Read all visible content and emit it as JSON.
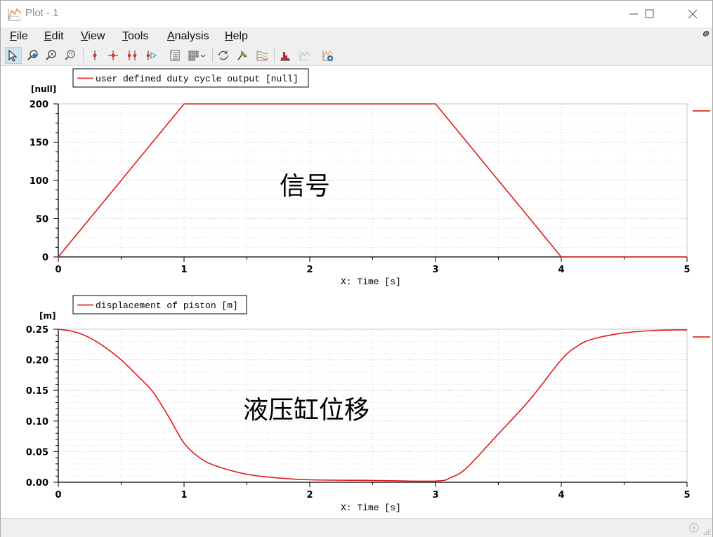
{
  "window": {
    "title": "Plot - 1",
    "controls": [
      "minimize",
      "maximize",
      "close"
    ]
  },
  "menu": [
    {
      "label": "File",
      "mnemonic": "F",
      "rest": "ile"
    },
    {
      "label": "Edit",
      "mnemonic": "E",
      "rest": "dit"
    },
    {
      "label": "View",
      "mnemonic": "V",
      "rest": "iew"
    },
    {
      "label": "Tools",
      "mnemonic": "T",
      "rest": "ools"
    },
    {
      "label": "Analysis",
      "mnemonic": "A",
      "rest": "nalysis"
    },
    {
      "label": "Help",
      "mnemonic": "H",
      "rest": "elp"
    }
  ],
  "toolbar": {
    "icons": [
      "select-arrow-icon",
      "zoom-region-icon",
      "zoom-fit-icon",
      "zoom-reset-icon",
      "vertical-cursor-icon",
      "crosshair-cursor-icon",
      "double-cursor-icon",
      "cursor-play-icon",
      "legend-list-icon",
      "layout-grid-icon",
      "refresh-icon",
      "pin-icon",
      "curves-icon",
      "histogram-icon",
      "xy-plot-icon",
      "add-plot-icon"
    ]
  },
  "colors": {
    "series": "#e01b1b",
    "legend_swatch": "#e8433a",
    "grid": "#c8c8c8",
    "frame": "#c4c4c4",
    "chrome": "#efefef"
  },
  "chart_data": [
    {
      "type": "line",
      "title": "",
      "legend": [
        "user defined duty cycle output [null]"
      ],
      "legend_placement": "top-left",
      "xlabel": "X: Time [s]",
      "ylabel": "[null]",
      "xlim": [
        0,
        5
      ],
      "ylim": [
        0,
        200
      ],
      "x_ticks": [
        "0",
        "1",
        "2",
        "3",
        "4",
        "5"
      ],
      "y_ticks": [
        "0",
        "50",
        "100",
        "150",
        "200"
      ],
      "grid": true,
      "annotation": "信号",
      "series": [
        {
          "name": "user defined duty cycle output [null]",
          "x": [
            0,
            1,
            3,
            4,
            5
          ],
          "y": [
            0,
            200,
            200,
            0,
            0
          ]
        }
      ]
    },
    {
      "type": "line",
      "title": "",
      "legend": [
        "displacement of piston [m]"
      ],
      "legend_placement": "top-left",
      "xlabel": "X: Time [s]",
      "ylabel": "[m]",
      "xlim": [
        0,
        5
      ],
      "ylim": [
        0,
        0.25
      ],
      "x_ticks": [
        "0",
        "1",
        "2",
        "3",
        "4",
        "5"
      ],
      "y_ticks": [
        "0.00",
        "0.05",
        "0.10",
        "0.15",
        "0.20",
        "0.25"
      ],
      "grid": true,
      "annotation": "液压缸位移",
      "series": [
        {
          "name": "displacement of piston [m]",
          "x": [
            0,
            0.125,
            0.25,
            0.375,
            0.5,
            0.625,
            0.75,
            0.875,
            1.0,
            1.125,
            1.25,
            1.5,
            1.75,
            2.0,
            2.5,
            3.0,
            3.125,
            3.25,
            3.5,
            3.75,
            4.0,
            4.125,
            4.25,
            4.5,
            4.75,
            5.0
          ],
          "y": [
            0.25,
            0.246,
            0.236,
            0.22,
            0.2,
            0.175,
            0.148,
            0.108,
            0.064,
            0.04,
            0.027,
            0.013,
            0.007,
            0.004,
            0.003,
            0.002,
            0.008,
            0.024,
            0.079,
            0.135,
            0.2,
            0.222,
            0.234,
            0.244,
            0.248,
            0.249
          ]
        }
      ]
    }
  ]
}
